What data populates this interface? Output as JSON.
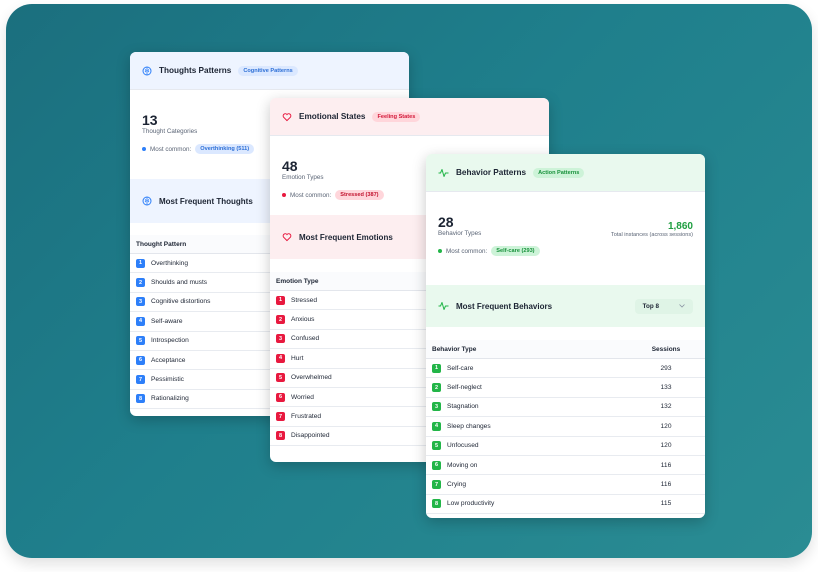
{
  "thoughts": {
    "title": "Thoughts Patterns",
    "tag": "Cognitive Patterns",
    "count": "13",
    "count_label": "Thought Categories",
    "most_common_label": "Most common:",
    "most_common_value": "Overthinking (511)",
    "section_title": "Most Frequent Thoughts",
    "column": "Thought Pattern",
    "items": [
      "Overthinking",
      "Shoulds and musts",
      "Cognitive distortions",
      "Self-aware",
      "Introspection",
      "Acceptance",
      "Pessimistic",
      "Rationalizing"
    ],
    "accent": "#2d7ff9"
  },
  "emotions": {
    "title": "Emotional States",
    "tag": "Feeling States",
    "count": "48",
    "count_label": "Emotion Types",
    "most_common_label": "Most common:",
    "most_common_value": "Stressed (387)",
    "section_title": "Most Frequent Emotions",
    "column": "Emotion Type",
    "items": [
      "Stressed",
      "Anxious",
      "Confused",
      "Hurt",
      "Overwhelmed",
      "Worried",
      "Frustrated",
      "Disappointed"
    ],
    "accent": "#e8193f"
  },
  "behaviors": {
    "title": "Behavior Patterns",
    "tag": "Action Patterns",
    "count": "28",
    "count_label": "Behavior Types",
    "total": "1,860",
    "total_label": "Total instances (across sessions)",
    "most_common_label": "Most common:",
    "most_common_value": "Self-care (293)",
    "section_title": "Most Frequent Behaviors",
    "dropdown_value": "Top 8",
    "column": "Behavior Type",
    "column2": "Sessions",
    "items": [
      {
        "name": "Self-care",
        "value": "293"
      },
      {
        "name": "Self-neglect",
        "value": "133"
      },
      {
        "name": "Stagnation",
        "value": "132"
      },
      {
        "name": "Sleep changes",
        "value": "120"
      },
      {
        "name": "Unfocused",
        "value": "120"
      },
      {
        "name": "Moving on",
        "value": "116"
      },
      {
        "name": "Crying",
        "value": "116"
      },
      {
        "name": "Low productivity",
        "value": "115"
      }
    ],
    "accent": "#22b548"
  }
}
